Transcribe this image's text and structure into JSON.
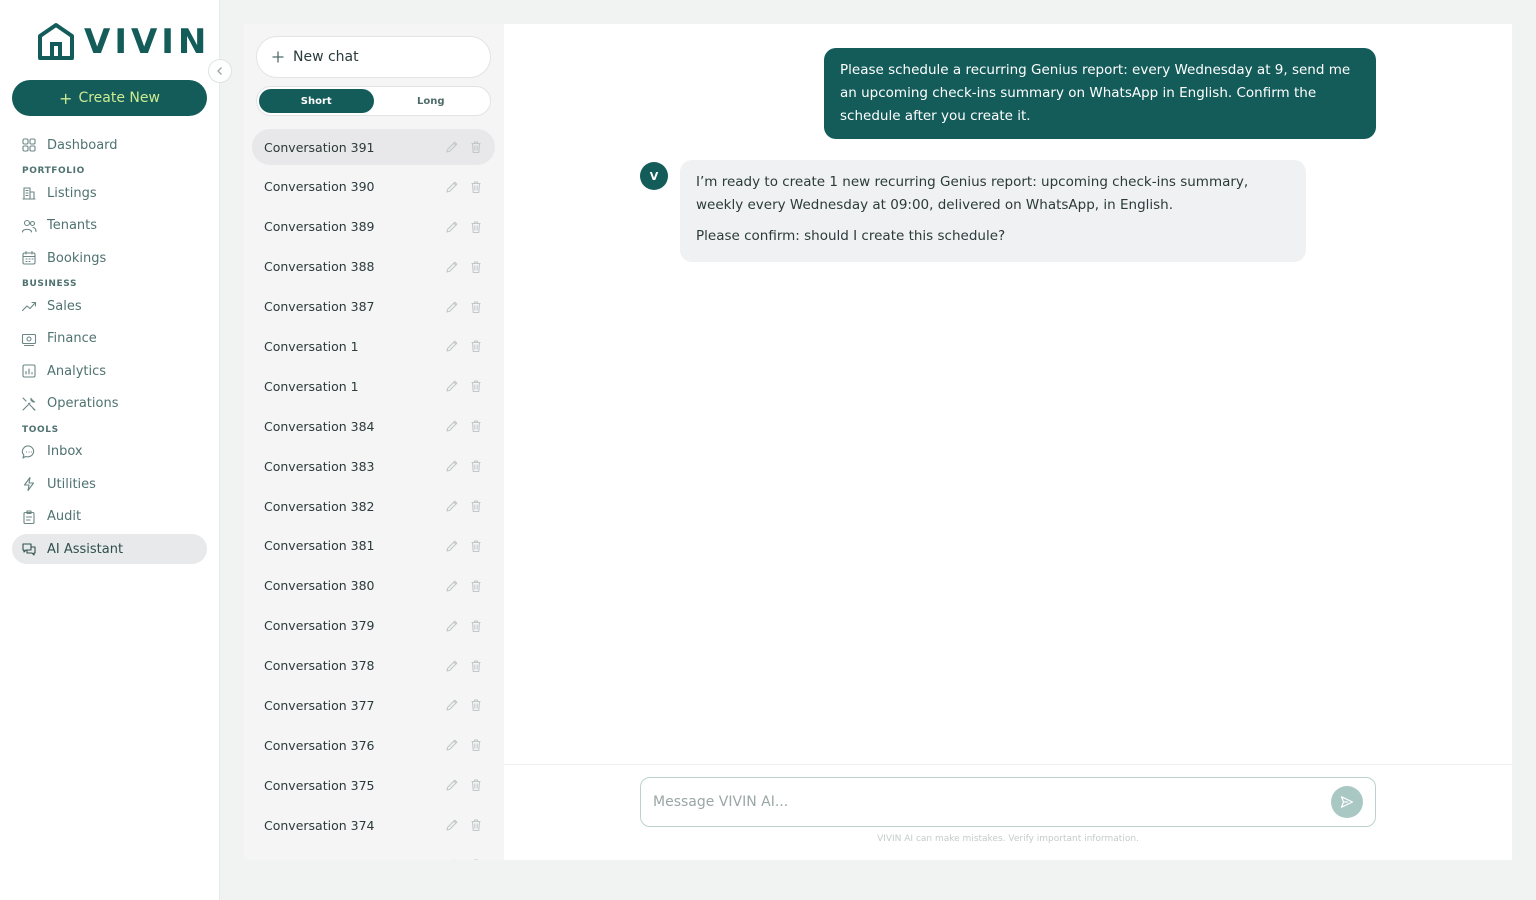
{
  "app": {
    "logo_text": "VIVIN"
  },
  "sidebar": {
    "create_label": "Create New",
    "items": [
      {
        "type": "item",
        "label": "Dashboard",
        "icon": "grid-icon"
      },
      {
        "type": "section",
        "label": "PORTFOLIO"
      },
      {
        "type": "item",
        "label": "Listings",
        "icon": "building-icon"
      },
      {
        "type": "item",
        "label": "Tenants",
        "icon": "users-icon"
      },
      {
        "type": "item",
        "label": "Bookings",
        "icon": "calendar-icon"
      },
      {
        "type": "section",
        "label": "BUSINESS"
      },
      {
        "type": "item",
        "label": "Sales",
        "icon": "trend-icon"
      },
      {
        "type": "item",
        "label": "Finance",
        "icon": "banknote-icon"
      },
      {
        "type": "item",
        "label": "Analytics",
        "icon": "bar-chart-icon"
      },
      {
        "type": "item",
        "label": "Operations",
        "icon": "tools-icon"
      },
      {
        "type": "section",
        "label": "TOOLS"
      },
      {
        "type": "item",
        "label": "Inbox",
        "icon": "chat-bubble-icon"
      },
      {
        "type": "item",
        "label": "Utilities",
        "icon": "bolt-icon"
      },
      {
        "type": "item",
        "label": "Audit",
        "icon": "clipboard-icon"
      },
      {
        "type": "item",
        "label": "AI Assistant",
        "icon": "ai-chat-icon",
        "active": true
      }
    ]
  },
  "conversations": {
    "new_chat_label": "New chat",
    "toggle": {
      "short": "Short",
      "long": "Long",
      "selected": "Short"
    },
    "items": [
      {
        "title": "Conversation 391",
        "active": true
      },
      {
        "title": "Conversation 390"
      },
      {
        "title": "Conversation 389"
      },
      {
        "title": "Conversation 388"
      },
      {
        "title": "Conversation 387"
      },
      {
        "title": "Conversation 1"
      },
      {
        "title": "Conversation 1"
      },
      {
        "title": "Conversation 384"
      },
      {
        "title": "Conversation 383"
      },
      {
        "title": "Conversation 382"
      },
      {
        "title": "Conversation 381"
      },
      {
        "title": "Conversation 380"
      },
      {
        "title": "Conversation 379"
      },
      {
        "title": "Conversation 378"
      },
      {
        "title": "Conversation 377"
      },
      {
        "title": "Conversation 376"
      },
      {
        "title": "Conversation 375"
      },
      {
        "title": "Conversation 374"
      },
      {
        "title": ""
      }
    ]
  },
  "chat": {
    "user_message": "Please schedule a recurring Genius report: every Wednesday at 9, send me an upcoming check-ins summary on WhatsApp in English. Confirm the schedule after you create it.",
    "assistant_avatar": "V",
    "assistant_message_1": "I’m ready to create 1 new recurring Genius report: upcoming check-ins summary, weekly every Wednesday at 09:00, delivered on WhatsApp, in English.",
    "assistant_message_2": "Please confirm: should I create this schedule?",
    "composer_placeholder": "Message VIVIN AI...",
    "disclaimer": "VIVIN AI can make mistakes. Verify important information."
  },
  "colors": {
    "brand": "#135c5a",
    "accent": "#cdeb92",
    "active_bg": "#e7e9ea"
  }
}
